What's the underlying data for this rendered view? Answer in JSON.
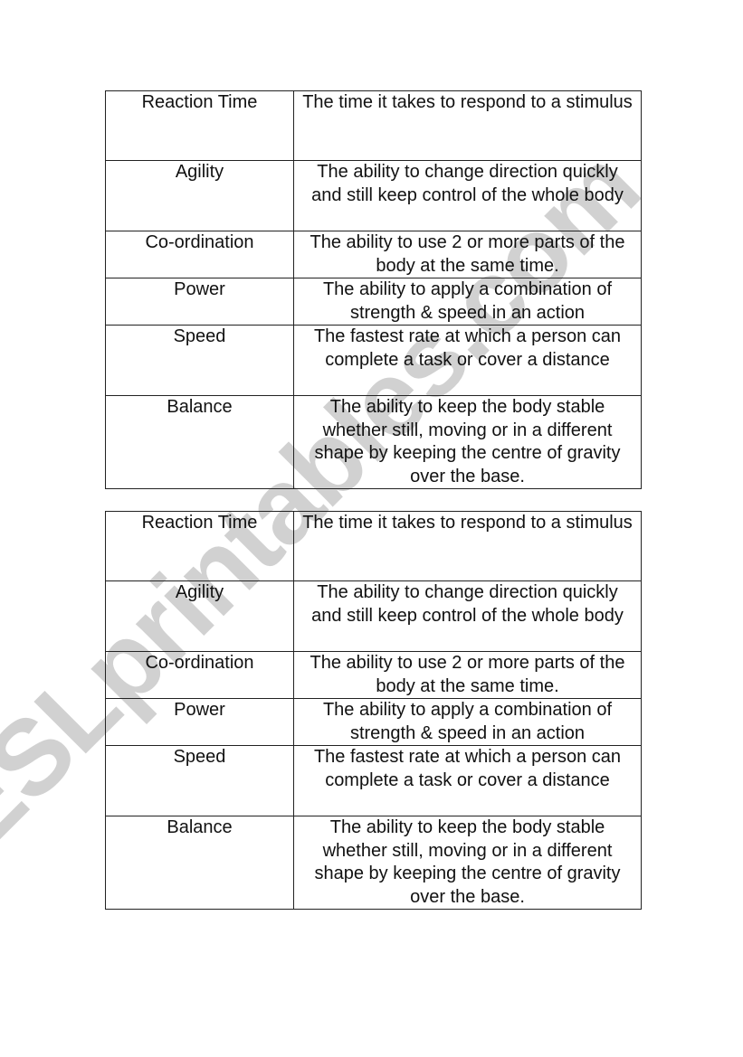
{
  "watermark": "ESLprintables.com",
  "tables": [
    {
      "rows": [
        {
          "term": "Reaction Time",
          "definition": "The time it takes to respond to a stimulus"
        },
        {
          "term": "Agility",
          "definition": "The ability to change direction quickly and still keep control of the whole body"
        },
        {
          "term": "Co-ordination",
          "definition": "The ability to use 2 or more parts of the body at the same time."
        },
        {
          "term": "Power",
          "definition": "The ability to apply a combination of strength & speed in an action"
        },
        {
          "term": "Speed",
          "definition": "The fastest rate at which a person can complete a task or cover a distance"
        },
        {
          "term": "Balance",
          "definition": "The ability to keep the body stable whether still, moving or in a different shape by keeping the centre of gravity over the base."
        }
      ]
    },
    {
      "rows": [
        {
          "term": "Reaction Time",
          "definition": "The time it takes to respond to a stimulus"
        },
        {
          "term": "Agility",
          "definition": "The ability to change direction quickly and still keep control of the whole body"
        },
        {
          "term": "Co-ordination",
          "definition": "The ability to use 2 or more parts of the body at the same time."
        },
        {
          "term": "Power",
          "definition": "The ability to apply a combination of strength & speed in an action"
        },
        {
          "term": "Speed",
          "definition": "The fastest rate at which a person can complete a task or cover a distance"
        },
        {
          "term": "Balance",
          "definition": "The ability to keep the body stable whether still, moving or in a different shape by keeping the centre of gravity over the base."
        }
      ]
    }
  ]
}
